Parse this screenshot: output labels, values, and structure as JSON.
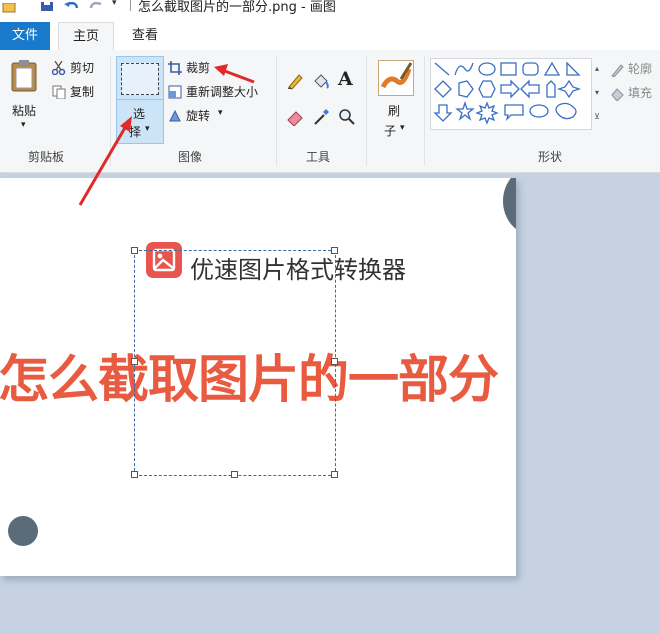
{
  "titlebar": {
    "title": "怎么截取图片的一部分.png - 画图"
  },
  "tabs": {
    "file": "文件",
    "home": "主页",
    "view": "查看"
  },
  "clipboard": {
    "paste": "粘贴",
    "cut": "剪切",
    "copy": "复制",
    "group": "剪贴板"
  },
  "image": {
    "select_line1": "选",
    "select_line2": "择",
    "crop": "裁剪",
    "resize": "重新调整大小",
    "rotate": "旋转",
    "group": "图像"
  },
  "tools": {
    "group": "工具",
    "text_tool": "A"
  },
  "brush": {
    "line1": "刷",
    "line2": "子"
  },
  "shapes": {
    "group": "形状",
    "outline": "轮廓",
    "fill": "填充"
  },
  "canvas": {
    "logo_text": "优速图片格式转换器",
    "headline": "怎么截取图片的一部分"
  },
  "colors": {
    "file_tab": "#1979ca",
    "headline": "#e85b40",
    "arrow": "#e02a2a",
    "logo_icon": "#e8554e",
    "workspace": "#c6d2e2"
  }
}
